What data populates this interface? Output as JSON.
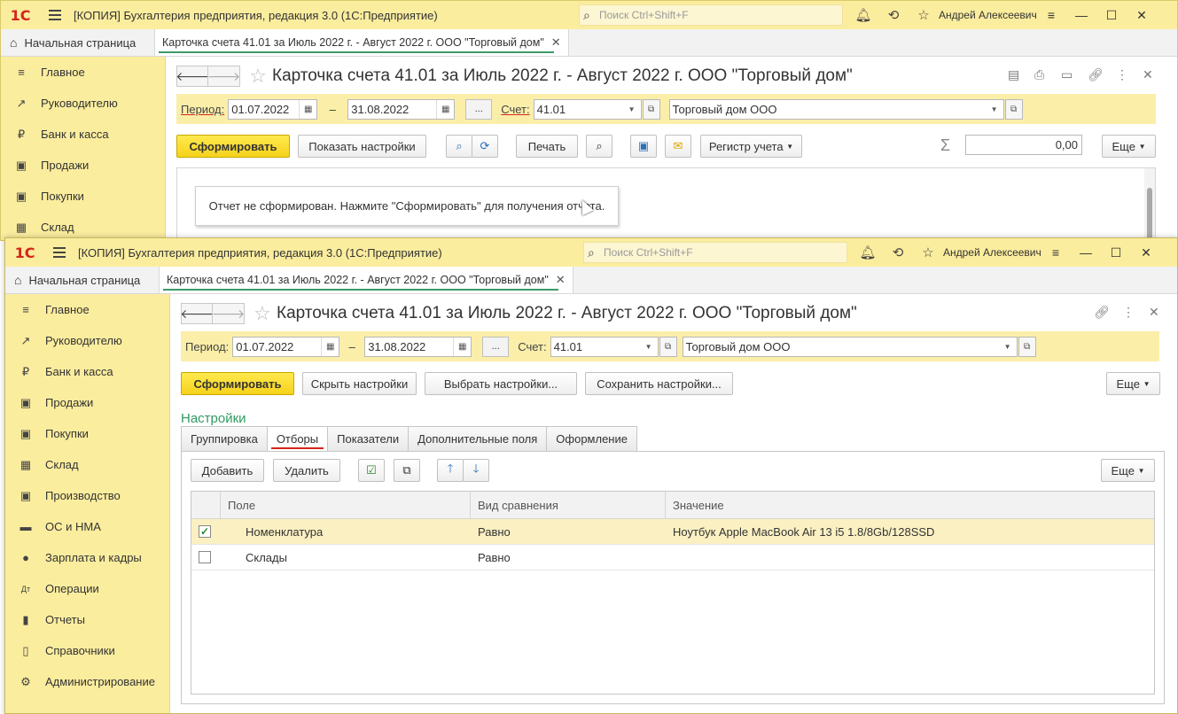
{
  "app_title": "[КОПИЯ] Бухгалтерия предприятия, редакция 3.0  (1С:Предприятие)",
  "logo_text": "1С",
  "search_placeholder": "Поиск Ctrl+Shift+F",
  "user_name": "Андрей Алексеевич",
  "home_tab": "Начальная страница",
  "doc_tab": "Карточка счета 41.01 за Июль 2022 г. - Август 2022 г. ООО \"Торговый дом\"",
  "doc_title": "Карточка счета 41.01 за Июль 2022 г. - Август 2022 г. ООО \"Торговый дом\"",
  "sidebar": {
    "items": [
      {
        "label": "Главное",
        "icon": "≡"
      },
      {
        "label": "Руководителю",
        "icon": "↗"
      },
      {
        "label": "Банк и касса",
        "icon": "₽"
      },
      {
        "label": "Продажи",
        "icon": "▣"
      },
      {
        "label": "Покупки",
        "icon": "▣"
      },
      {
        "label": "Склад",
        "icon": "▦"
      },
      {
        "label": "Производство",
        "icon": "▣"
      },
      {
        "label": "ОС и НМА",
        "icon": "▬"
      },
      {
        "label": "Зарплата и кадры",
        "icon": "●"
      },
      {
        "label": "Операции",
        "icon": "Дт"
      },
      {
        "label": "Отчеты",
        "icon": "▮"
      },
      {
        "label": "Справочники",
        "icon": "▯"
      },
      {
        "label": "Администрирование",
        "icon": "⚙"
      }
    ]
  },
  "params": {
    "period_label": "Период:",
    "date_from": "01.07.2022",
    "dash": "–",
    "date_to": "31.08.2022",
    "dots": "...",
    "account_label": "Счет:",
    "account": "41.01",
    "org": "Торговый дом ООО"
  },
  "w1": {
    "form_button": "Сформировать",
    "show_settings": "Показать настройки",
    "print": "Печать",
    "register": "Регистр учета",
    "sum_value": "0,00",
    "more": "Еще",
    "message": "Отчет не сформирован. Нажмите \"Сформировать\" для получения отчета."
  },
  "w2": {
    "form_button": "Сформировать",
    "hide_settings": "Скрыть настройки",
    "choose_settings": "Выбрать настройки...",
    "save_settings": "Сохранить настройки...",
    "more": "Еще",
    "settings_title": "Настройки",
    "tabs": [
      "Группировка",
      "Отборы",
      "Показатели",
      "Дополнительные поля",
      "Оформление"
    ],
    "add": "Добавить",
    "delete": "Удалить",
    "more2": "Еще",
    "columns": [
      "Поле",
      "Вид сравнения",
      "Значение"
    ],
    "rows": [
      {
        "field": "Номенклатура",
        "cmp": "Равно",
        "value": "Ноутбук Apple MacBook Air 13 i5 1.8/8Gb/128SSD",
        "checked": true
      },
      {
        "field": "Склады",
        "cmp": "Равно",
        "value": "",
        "checked": false
      }
    ]
  }
}
